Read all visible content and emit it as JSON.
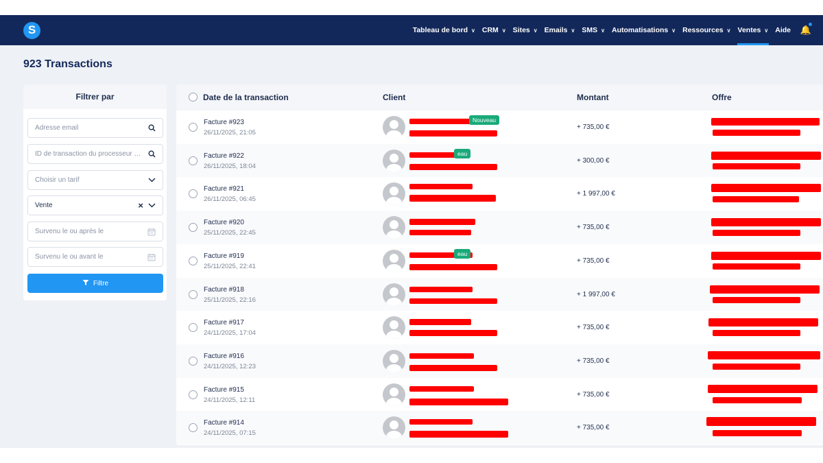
{
  "nav": {
    "items": [
      {
        "label": "Tableau de bord",
        "chevron": true,
        "active": false
      },
      {
        "label": "CRM",
        "chevron": true,
        "active": false
      },
      {
        "label": "Sites",
        "chevron": true,
        "active": false
      },
      {
        "label": "Emails",
        "chevron": true,
        "active": false
      },
      {
        "label": "SMS",
        "chevron": true,
        "active": false
      },
      {
        "label": "Automatisations",
        "chevron": true,
        "active": false
      },
      {
        "label": "Ressources",
        "chevron": true,
        "active": false
      },
      {
        "label": "Ventes",
        "chevron": true,
        "active": true
      },
      {
        "label": "Aide",
        "chevron": false,
        "active": false
      }
    ],
    "logo_letter": "S",
    "accent": "#2196f3",
    "bg": "#13285a"
  },
  "page": {
    "title": "923 Transactions"
  },
  "filter": {
    "title": "Filtrer par",
    "fields": [
      {
        "text": "Adresse email",
        "kind": "placeholder",
        "icon": "search-icon"
      },
      {
        "text": "ID de transaction du processeur de paiement",
        "kind": "placeholder",
        "icon": "search-icon"
      },
      {
        "text": "Choisir un tarif",
        "kind": "placeholder",
        "icon": "chevron-down-icon"
      },
      {
        "text": "Vente",
        "kind": "value",
        "icon": "clear-and-chevron"
      },
      {
        "text": "Survenu le ou après le",
        "kind": "placeholder",
        "icon": "calendar-icon"
      },
      {
        "text": "Survenu le ou avant le",
        "kind": "placeholder",
        "icon": "calendar-icon"
      }
    ],
    "button_label": "Filtre"
  },
  "table": {
    "columns": [
      "Date de la transaction",
      "Client",
      "Montant",
      "Offre"
    ],
    "rows": [
      {
        "invoice": "Facture #923",
        "date": "26/11/2025, 21:05",
        "amount": "+ 735,00 €",
        "badge": "Nouveau"
      },
      {
        "invoice": "Facture #922",
        "date": "26/11/2025, 18:04",
        "amount": "+ 300,00 €",
        "badge": "eau"
      },
      {
        "invoice": "Facture #921",
        "date": "26/11/2025, 06:45",
        "amount": "+ 1 997,00 €",
        "badge": ""
      },
      {
        "invoice": "Facture #920",
        "date": "25/11/2025, 22:45",
        "amount": "+ 735,00 €",
        "badge": ""
      },
      {
        "invoice": "Facture #919",
        "date": "25/11/2025, 22:41",
        "amount": "+ 735,00 €",
        "badge": "eau"
      },
      {
        "invoice": "Facture #918",
        "date": "25/11/2025, 22:16",
        "amount": "+ 1 997,00 €",
        "badge": ""
      },
      {
        "invoice": "Facture #917",
        "date": "24/11/2025, 17:04",
        "amount": "+ 735,00 €",
        "badge": ""
      },
      {
        "invoice": "Facture #916",
        "date": "24/11/2025, 12:23",
        "amount": "+ 735,00 €",
        "badge": ""
      },
      {
        "invoice": "Facture #915",
        "date": "24/11/2025, 12:11",
        "amount": "+ 735,00 €",
        "badge": ""
      },
      {
        "invoice": "Facture #914",
        "date": "24/11/2025, 07:15",
        "amount": "+ 735,00 €",
        "badge": ""
      }
    ],
    "redaction_color": "#ff0000",
    "badge_color": "#1aaa7a"
  }
}
